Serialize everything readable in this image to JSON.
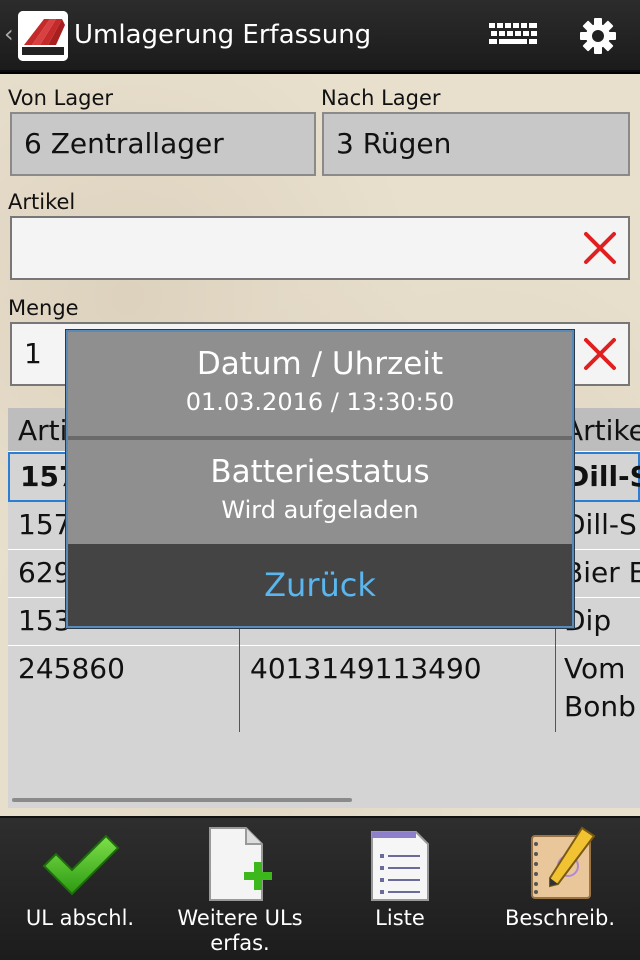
{
  "actionbar": {
    "title": "Umlagerung Erfassung",
    "icons": [
      "app-logo",
      "keyboard-icon",
      "gear-icon"
    ]
  },
  "form": {
    "von_lager_label": "Von Lager",
    "von_lager_value": "6 Zentrallager",
    "nach_lager_label": "Nach Lager",
    "nach_lager_value": "3 Rügen",
    "artikel_label": "Artikel",
    "artikel_value": "",
    "menge_label": "Menge",
    "menge_value": "1"
  },
  "table": {
    "headers": [
      "Arti",
      "",
      "Artike"
    ],
    "rows": [
      {
        "c1": "157",
        "c2": "",
        "c3": "Dill-S"
      },
      {
        "c1": "157",
        "c2": "",
        "c3": "Dill-S"
      },
      {
        "c1": "629",
        "c2": "",
        "c3": "Bier E"
      },
      {
        "c1": "153",
        "c2": "",
        "c3": "Dip"
      },
      {
        "c1": "245860",
        "c2": "4013149113490",
        "c3": "Vom",
        "c3b": "Bonb"
      }
    ]
  },
  "dialog": {
    "datetime_title": "Datum / Uhrzeit",
    "datetime_value": "01.03.2016 / 13:30:50",
    "battery_title": "Batteriestatus",
    "battery_value": "Wird aufgeladen",
    "back_button": "Zurück"
  },
  "bottombar": {
    "items": [
      {
        "label": "UL abschl.",
        "icon": "checkmark-icon"
      },
      {
        "label": "Weitere ULs erfas.",
        "icon": "new-document-icon"
      },
      {
        "label": "Liste",
        "icon": "list-document-icon"
      },
      {
        "label": "Beschreib.",
        "icon": "notebook-pencil-icon"
      }
    ]
  },
  "colors": {
    "accent": "#59b6ee",
    "clear_x": "#e02020",
    "checkmark": "#3cb81c"
  }
}
